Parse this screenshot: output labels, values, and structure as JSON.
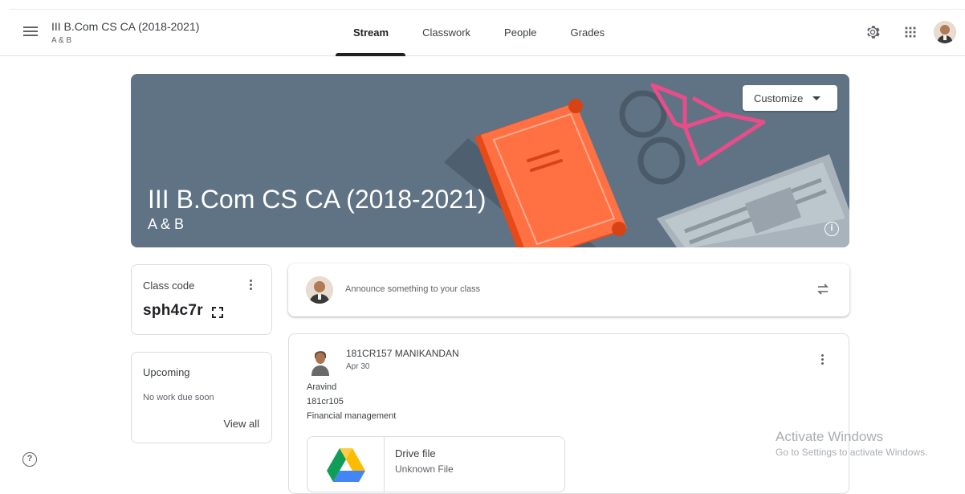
{
  "header": {
    "class_title": "III B.Com CS CA (2018-2021)",
    "class_section": "A & B",
    "tabs": [
      {
        "label": "Stream",
        "active": true
      },
      {
        "label": "Classwork",
        "active": false
      },
      {
        "label": "People",
        "active": false
      },
      {
        "label": "Grades",
        "active": false
      }
    ],
    "icons": [
      "menu-icon",
      "settings-icon",
      "apps-grid-icon",
      "avatar"
    ]
  },
  "banner": {
    "title": "III B.Com CS CA (2018-2021)",
    "subtitle": "A & B",
    "customize_label": "Customize",
    "info_glyph": "i",
    "color": "#5f7384"
  },
  "class_code": {
    "label": "Class code",
    "value": "sph4c7r"
  },
  "upcoming": {
    "title": "Upcoming",
    "status": "No work due soon",
    "link": "View all"
  },
  "announce": {
    "placeholder": "Announce something to your class"
  },
  "post": {
    "author": "181CR157 MANIKANDAN",
    "date": "Apr 30",
    "lines": [
      "Aravind",
      "181cr105",
      "Financial management"
    ],
    "attachment": {
      "title": "Drive file",
      "subtitle": "Unknown File"
    }
  },
  "help": {
    "glyph": "?"
  },
  "watermark": {
    "title": "Activate Windows",
    "subtitle": "Go to Settings to activate Windows."
  }
}
